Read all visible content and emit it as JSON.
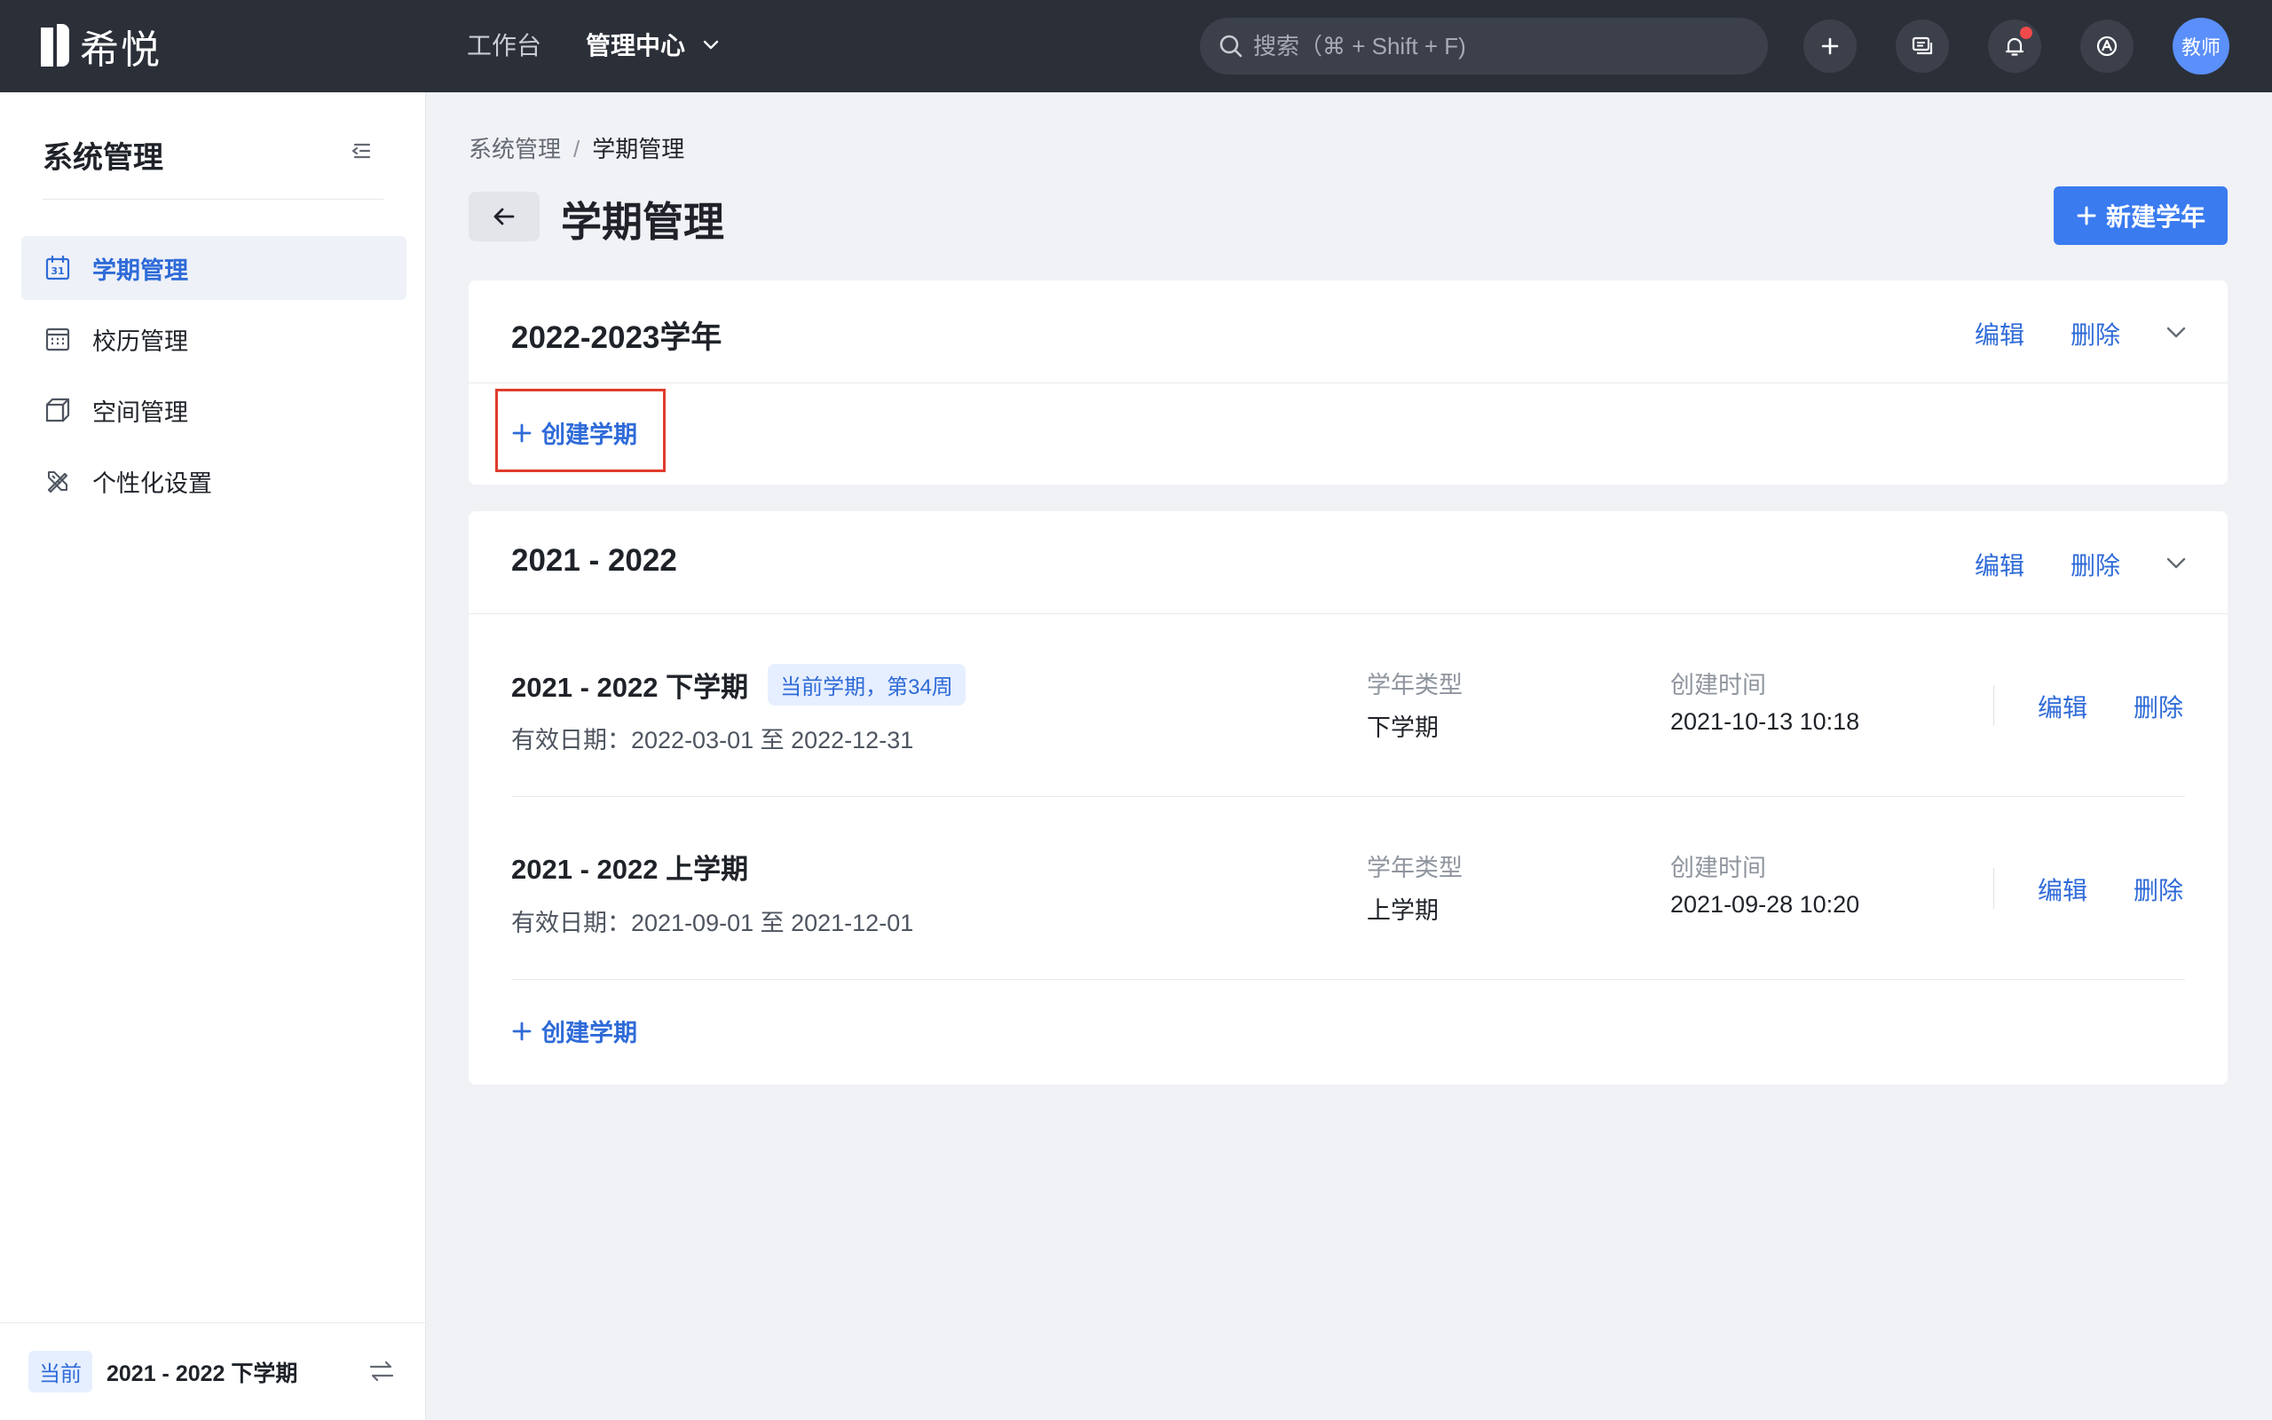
{
  "app": {
    "name": "希悦",
    "avatar_label": "教师"
  },
  "topnav": {
    "workbench": "工作台",
    "admin_center": "管理中心"
  },
  "search": {
    "placeholder": "搜索（⌘ + Shift + F)"
  },
  "sidebar": {
    "title": "系统管理",
    "items": [
      {
        "label": "学期管理",
        "icon": "calendar-icon",
        "active": true
      },
      {
        "label": "校历管理",
        "icon": "calendar-grid-icon",
        "active": false
      },
      {
        "label": "空间管理",
        "icon": "cube-icon",
        "active": false
      },
      {
        "label": "个性化设置",
        "icon": "design-tools-icon",
        "active": false
      }
    ],
    "footer": {
      "tag": "当前",
      "term": "2021 - 2022 下学期"
    }
  },
  "breadcrumb": {
    "root": "系统管理",
    "separator": "/",
    "current": "学期管理"
  },
  "page": {
    "title": "学期管理",
    "new_year_label": "新建学年"
  },
  "actions": {
    "edit": "编辑",
    "delete": "删除",
    "create_term": "创建学期"
  },
  "years": [
    {
      "title": "2022-2023学年",
      "terms": []
    },
    {
      "title": "2021 - 2022",
      "terms": [
        {
          "name": "2021 - 2022 下学期",
          "badge": "当前学期，第34周",
          "date": "有效日期：2022-03-01 至 2022-12-31",
          "type_label": "学年类型",
          "type_value": "下学期",
          "created_label": "创建时间",
          "created_value": "2021-10-13 10:18"
        },
        {
          "name": "2021 - 2022 上学期",
          "date": "有效日期：2021-09-01 至 2021-12-01",
          "type_label": "学年类型",
          "type_value": "上学期",
          "created_label": "创建时间",
          "created_value": "2021-09-28 10:20"
        }
      ]
    }
  ],
  "colors": {
    "topbar": "#2b2f38",
    "accent": "#3a7bf0",
    "link": "#2f6bd8",
    "highlight": "#e03c2c"
  }
}
